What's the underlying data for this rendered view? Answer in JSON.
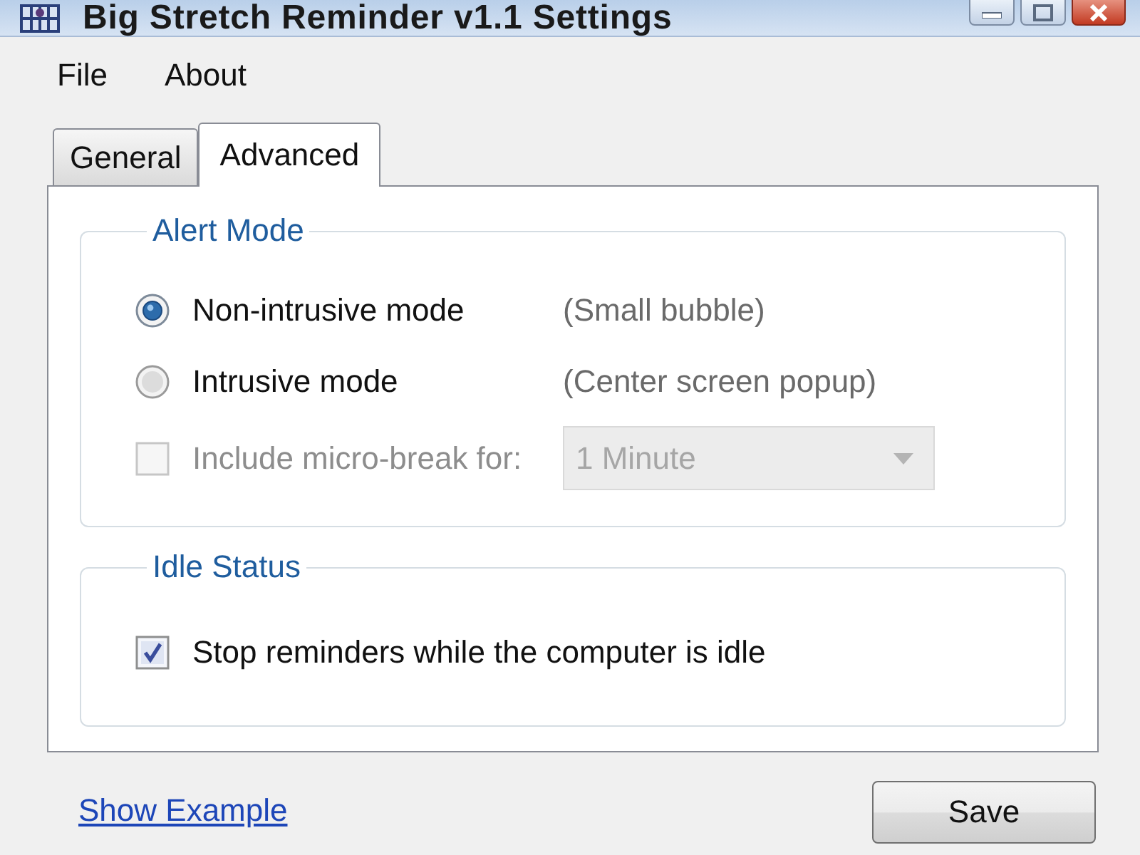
{
  "window": {
    "title": "Big Stretch Reminder v1.1 Settings"
  },
  "menu": [
    {
      "label": "File"
    },
    {
      "label": "About"
    }
  ],
  "tabs": [
    {
      "label": "General",
      "selected": false
    },
    {
      "label": "Advanced",
      "selected": true
    }
  ],
  "groups": [
    {
      "title": "Alert Mode",
      "options": [
        {
          "kind": "radio",
          "label": "Non-intrusive mode",
          "selected": true,
          "disabled": false,
          "note": "(Small bubble)"
        },
        {
          "kind": "radio",
          "label": "Intrusive mode",
          "selected": false,
          "disabled": false,
          "note": "(Center screen popup)"
        },
        {
          "kind": "checkbox",
          "label": "Include micro-break for:",
          "checked": false,
          "disabled": true,
          "dropdown": {
            "value": "1 Minute"
          }
        }
      ]
    },
    {
      "title": "Idle Status",
      "options": [
        {
          "kind": "checkbox",
          "label": "Stop reminders while the computer is idle",
          "checked": true,
          "disabled": false
        }
      ]
    }
  ],
  "footer": {
    "link": "Show Example",
    "button": "Save"
  }
}
